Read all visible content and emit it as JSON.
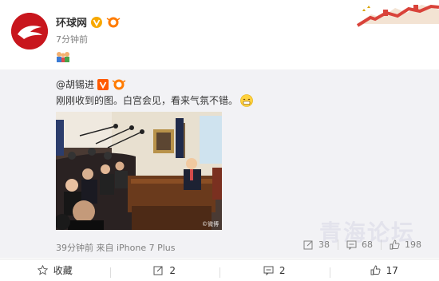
{
  "post": {
    "author": "环球网",
    "time": "7分钟前"
  },
  "repost": {
    "author": "@胡锡进",
    "text": "刚刚收到的图。白宫会见，看来气氛不错。",
    "meta": "39分钟前 来自 iPhone 7 Plus",
    "photo_watermark": "©微博",
    "actions": {
      "share_count": "38",
      "comment_count": "68",
      "like_count": "198"
    }
  },
  "footer": {
    "collect_label": "收藏",
    "share_count": "2",
    "comment_count": "2",
    "like_count": "17"
  },
  "watermark": "青海论坛",
  "colors": {
    "brand": "#c8161d",
    "verified": "#f7a800",
    "vip": "#ff7b00",
    "muted": "#808080",
    "repost_bg": "#f2f2f5"
  },
  "icons": [
    "verified-icon",
    "vip-icon",
    "share-icon",
    "comment-icon",
    "like-icon",
    "star-icon"
  ]
}
